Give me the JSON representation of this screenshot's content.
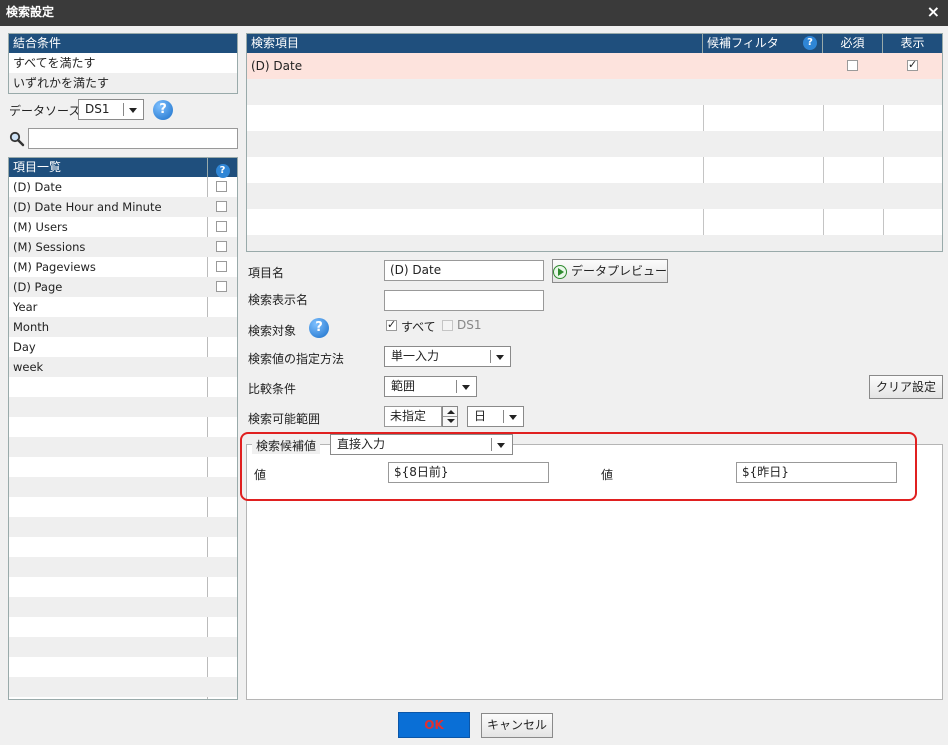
{
  "window": {
    "title": "検索設定",
    "close_label": "×"
  },
  "combine": {
    "header": "結合条件",
    "options": [
      "すべてを満たす",
      "いずれかを満たす"
    ]
  },
  "datasource": {
    "label": "データソース",
    "value": "DS1",
    "help_icon": "question-icon"
  },
  "search": {
    "placeholder": "",
    "value": ""
  },
  "item_list": {
    "header": "項目一覧",
    "items": [
      {
        "label": "(D) Date",
        "checkbox": true
      },
      {
        "label": "(D) Date Hour and Minute",
        "checkbox": true
      },
      {
        "label": "(M) Users",
        "checkbox": true
      },
      {
        "label": "(M) Sessions",
        "checkbox": true
      },
      {
        "label": "(M) Pageviews",
        "checkbox": true
      },
      {
        "label": "(D) Page",
        "checkbox": true
      },
      {
        "label": "Year",
        "checkbox": false
      },
      {
        "label": "Month",
        "checkbox": false
      },
      {
        "label": "Day",
        "checkbox": false
      },
      {
        "label": "week",
        "checkbox": false
      }
    ]
  },
  "search_grid": {
    "columns": [
      "検索項目",
      "候補フィルタ",
      "必須",
      "表示"
    ],
    "rows": [
      {
        "item": "(D) Date",
        "filter": "",
        "required": false,
        "display": true
      }
    ]
  },
  "form": {
    "item_name_label": "項目名",
    "item_name_value": "(D) Date",
    "preview_button": "データプレビュー",
    "display_name_label": "検索表示名",
    "display_name_value": "",
    "target_label": "検索対象",
    "target_all_label": "すべて",
    "target_all_checked": true,
    "target_ds1_label": "DS1",
    "target_ds1_checked": false,
    "method_label": "検索値の指定方法",
    "method_value": "単一入力",
    "compare_label": "比較条件",
    "compare_value": "範囲",
    "clear_button": "クリア設定",
    "range_label": "検索可能範囲",
    "range_value": "未指定",
    "range_unit": "日"
  },
  "candidate": {
    "legend": "検索候補値",
    "mode": "直接入力",
    "value1_label": "値",
    "value1": "${8日前}",
    "value2_label": "値",
    "value2": "${昨日}"
  },
  "footer": {
    "ok_label": "OK",
    "cancel_label": "キャンセル"
  },
  "colors": {
    "header_bg": "#1f4f7d",
    "titlebar_bg": "#3a3a3a",
    "selected_row": "#fde3dd",
    "highlight": "#e02020",
    "ok_bg": "#0a6fd6"
  }
}
